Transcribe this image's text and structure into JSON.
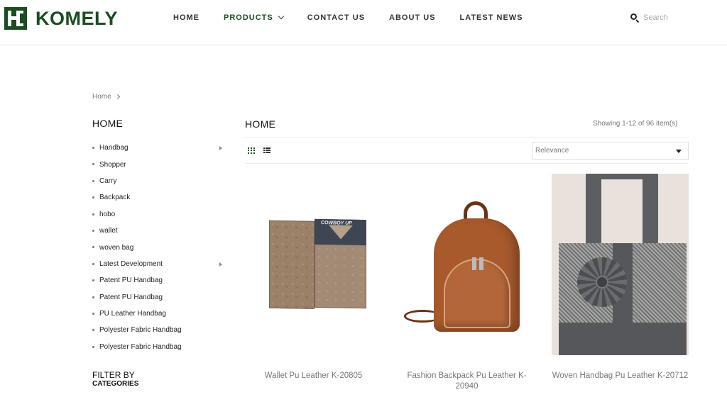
{
  "brand": {
    "logo_text": "KOMELY",
    "accent": "#1a4d20"
  },
  "nav": {
    "items": [
      {
        "label": "HOME"
      },
      {
        "label": "PRODUCTS"
      },
      {
        "label": "CONTACT US"
      },
      {
        "label": "ABOUT US"
      },
      {
        "label": "LATEST NEWS"
      }
    ],
    "active": "PRODUCTS"
  },
  "search": {
    "placeholder": "Search",
    "icon": "search-icon"
  },
  "breadcrumb": {
    "home": "Home"
  },
  "sidebar": {
    "title": "HOME",
    "categories": [
      {
        "label": "Handbag",
        "has_children": true
      },
      {
        "label": "Shopper"
      },
      {
        "label": "Carry"
      },
      {
        "label": "Backpack"
      },
      {
        "label": "hobo"
      },
      {
        "label": "wallet"
      },
      {
        "label": "woven bag"
      },
      {
        "label": "Latest Development",
        "has_children": true
      },
      {
        "label": "Patent PU Handbag"
      },
      {
        "label": "Patent PU Handbag"
      },
      {
        "label": "PU Leather Handbag"
      },
      {
        "label": "Polyester Fabric Handbag"
      },
      {
        "label": "Polyester Fabric Handbag"
      }
    ],
    "filter_title": "FILTER BY",
    "filter_subtitle": "CATEGORIES"
  },
  "main": {
    "title": "HOME",
    "showing": "Showing 1-12 of 96 item(s)",
    "view_icons": [
      "grid-view-icon",
      "list-view-icon"
    ],
    "sort": {
      "value": "Relevance"
    }
  },
  "products": [
    {
      "name": "Wallet Pu Leather K-20805"
    },
    {
      "name": "Fashion Backpack Pu Leather K-20940"
    },
    {
      "name": "Woven Handbag Pu Leather K-20712"
    }
  ]
}
